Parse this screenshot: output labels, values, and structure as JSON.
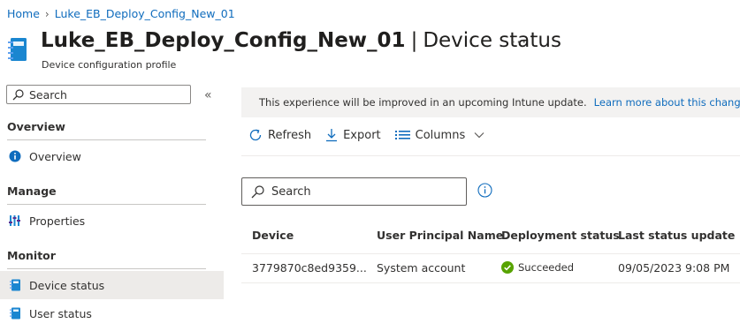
{
  "breadcrumb": {
    "home": "Home",
    "current": "Luke_EB_Deploy_Config_New_01"
  },
  "header": {
    "title": "Luke_EB_Deploy_Config_New_01",
    "separator": "|",
    "page": "Device status",
    "subtitle": "Device configuration profile",
    "more": "···"
  },
  "nav": {
    "search_placeholder": "Search",
    "collapse": "«",
    "sections": [
      {
        "label": "Overview"
      },
      {
        "label": "Manage"
      },
      {
        "label": "Monitor"
      }
    ],
    "items": [
      {
        "label": "Overview",
        "icon": "info-icon"
      },
      {
        "label": "Properties",
        "icon": "properties-icon"
      },
      {
        "label": "Device status",
        "icon": "notebook-icon",
        "selected": true
      },
      {
        "label": "User status",
        "icon": "notebook-icon"
      }
    ]
  },
  "banner": {
    "text": "This experience will be improved in an upcoming Intune update.",
    "link": "Learn more about this change."
  },
  "toolbar": {
    "refresh": "Refresh",
    "export": "Export",
    "columns": "Columns"
  },
  "search": {
    "placeholder": "Search"
  },
  "table": {
    "columns": [
      "Device",
      "User Principal Name",
      "Deployment status",
      "Last status update"
    ],
    "rows": [
      {
        "device": "3779870c8ed9359...",
        "upn": "System account",
        "status": "Succeeded",
        "updated": "09/05/2023 9:08 PM"
      }
    ]
  },
  "colors": {
    "accent": "#0f6cbd",
    "success": "#57a300",
    "selected_bg": "#edebe9",
    "banner_bg": "#f3f2f1"
  }
}
